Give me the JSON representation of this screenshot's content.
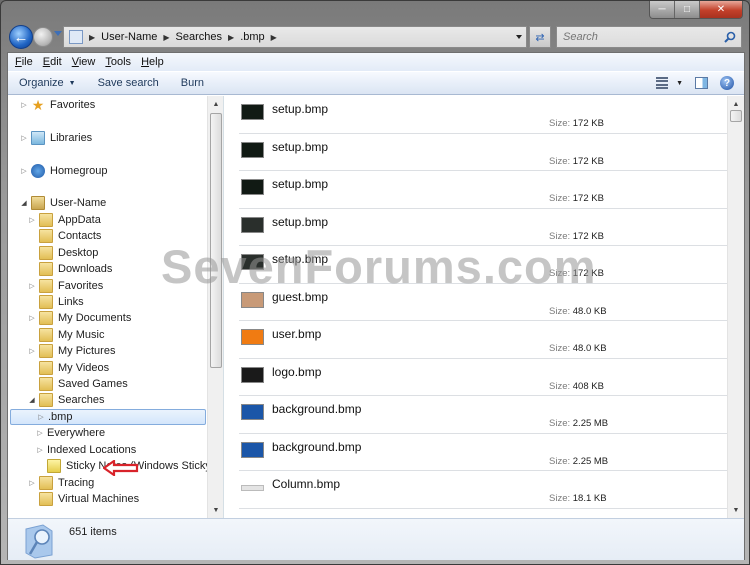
{
  "window": {
    "caption_buttons": [
      "minimize",
      "maximize",
      "close"
    ]
  },
  "navbar": {
    "breadcrumbs": [
      "User-Name",
      "Searches",
      ".bmp"
    ],
    "search_placeholder": "Search"
  },
  "menubar": {
    "items": [
      {
        "label": "File",
        "accel": "F"
      },
      {
        "label": "Edit",
        "accel": "E"
      },
      {
        "label": "View",
        "accel": "V"
      },
      {
        "label": "Tools",
        "accel": "T"
      },
      {
        "label": "Help",
        "accel": "H"
      }
    ]
  },
  "toolbar": {
    "organize": "Organize",
    "save_search": "Save search",
    "burn": "Burn"
  },
  "navpane": {
    "items": [
      {
        "label": "Favorites",
        "icon": "star-icon",
        "level": 0,
        "expander": "collapsed"
      },
      {
        "label": "Libraries",
        "icon": "libraries-icon",
        "level": 0,
        "expander": "collapsed"
      },
      {
        "label": "Homegroup",
        "icon": "homegroup-icon",
        "level": 0,
        "expander": "collapsed"
      },
      {
        "label": "User-Name",
        "icon": "user-folder-icon",
        "level": 0,
        "expander": "expanded"
      },
      {
        "label": "AppData",
        "icon": "folder-icon",
        "level": 1,
        "expander": "collapsed"
      },
      {
        "label": "Contacts",
        "icon": "folder-icon",
        "level": 1,
        "expander": "none"
      },
      {
        "label": "Desktop",
        "icon": "folder-icon",
        "level": 1,
        "expander": "none"
      },
      {
        "label": "Downloads",
        "icon": "folder-icon",
        "level": 1,
        "expander": "none"
      },
      {
        "label": "Favorites",
        "icon": "folder-icon",
        "level": 1,
        "expander": "collapsed"
      },
      {
        "label": "Links",
        "icon": "folder-icon",
        "level": 1,
        "expander": "none"
      },
      {
        "label": "My Documents",
        "icon": "folder-icon",
        "level": 1,
        "expander": "collapsed"
      },
      {
        "label": "My Music",
        "icon": "folder-icon",
        "level": 1,
        "expander": "none"
      },
      {
        "label": "My Pictures",
        "icon": "folder-icon",
        "level": 1,
        "expander": "collapsed"
      },
      {
        "label": "My Videos",
        "icon": "folder-icon",
        "level": 1,
        "expander": "none"
      },
      {
        "label": "Saved Games",
        "icon": "folder-icon",
        "level": 1,
        "expander": "none"
      },
      {
        "label": "Searches",
        "icon": "folder-icon",
        "level": 1,
        "expander": "expanded"
      },
      {
        "label": ".bmp",
        "icon": "saved-search-icon",
        "level": 2,
        "expander": "collapsed",
        "selected": true
      },
      {
        "label": "Everywhere",
        "icon": "saved-search-icon",
        "level": 2,
        "expander": "collapsed"
      },
      {
        "label": "Indexed Locations",
        "icon": "saved-search-icon",
        "level": 2,
        "expander": "collapsed"
      },
      {
        "label": "Sticky Notes (Windows Sticky Notes)",
        "icon": "sticky-notes-icon",
        "level": 2,
        "expander": "none"
      },
      {
        "label": "Tracing",
        "icon": "folder-icon",
        "level": 1,
        "expander": "collapsed"
      },
      {
        "label": "Virtual Machines",
        "icon": "folder-icon",
        "level": 1,
        "expander": "none"
      }
    ]
  },
  "content": {
    "size_label": "Size:",
    "files": [
      {
        "name": "setup.bmp",
        "size": "172 KB",
        "thumb": "#111a14"
      },
      {
        "name": "setup.bmp",
        "size": "172 KB",
        "thumb": "#111a14"
      },
      {
        "name": "setup.bmp",
        "size": "172 KB",
        "thumb": "#111a14"
      },
      {
        "name": "setup.bmp",
        "size": "172 KB",
        "thumb": "#2a2f2c"
      },
      {
        "name": "setup.bmp",
        "size": "172 KB",
        "thumb": "#2a2f2c"
      },
      {
        "name": "guest.bmp",
        "size": "48.0 KB",
        "thumb": "#c89a78"
      },
      {
        "name": "user.bmp",
        "size": "48.0 KB",
        "thumb": "#f07b12"
      },
      {
        "name": "logo.bmp",
        "size": "408 KB",
        "thumb": "#1a1a1a"
      },
      {
        "name": "background.bmp",
        "size": "2.25 MB",
        "thumb": "#1b56a8"
      },
      {
        "name": "background.bmp",
        "size": "2.25 MB",
        "thumb": "#1b56a8"
      },
      {
        "name": "Column.bmp",
        "size": "18.1 KB",
        "thumb": "#e4e4e4"
      }
    ]
  },
  "status": {
    "item_count": "651 items"
  },
  "watermark": "SevenForums.com",
  "colors": {
    "selection_bg": "#d4e6fb",
    "selection_border": "#84acdd",
    "toolbar_text": "#1e395b",
    "annotation_arrow": "#d8232a"
  }
}
